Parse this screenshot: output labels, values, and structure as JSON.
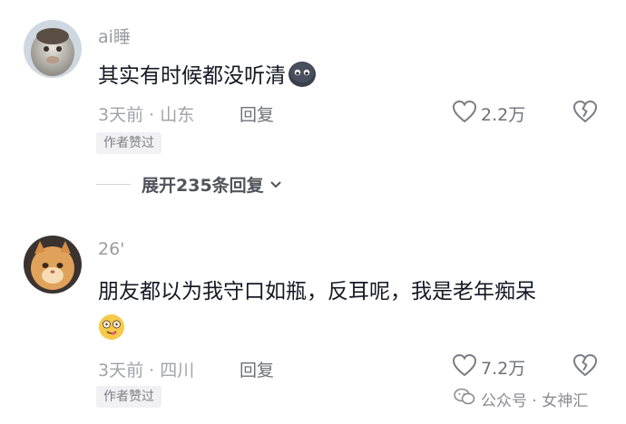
{
  "comments": [
    {
      "username": "ai睡",
      "text": "其实有时候都没听清",
      "emoji_icon": "sad-face-emoji-icon",
      "meta": "3天前 · 山东",
      "reply_label": "回复",
      "like_count": "2.2万",
      "badge": "作者赞过"
    },
    {
      "username": "26'",
      "text": "朋友都以为我守口如瓶，反耳呢，我是老年痴呆",
      "emoji_icon": "dizzy-face-emoji-icon",
      "meta": "3天前 · 四川",
      "reply_label": "回复",
      "like_count": "7.2万",
      "badge": "作者赞过"
    }
  ],
  "expand_replies": "展开235条回复",
  "watermark": "公众号 · 女神汇",
  "colors": {
    "text": "#161823",
    "muted": "#a2a3a8",
    "badge_bg": "#f1f1f3"
  }
}
